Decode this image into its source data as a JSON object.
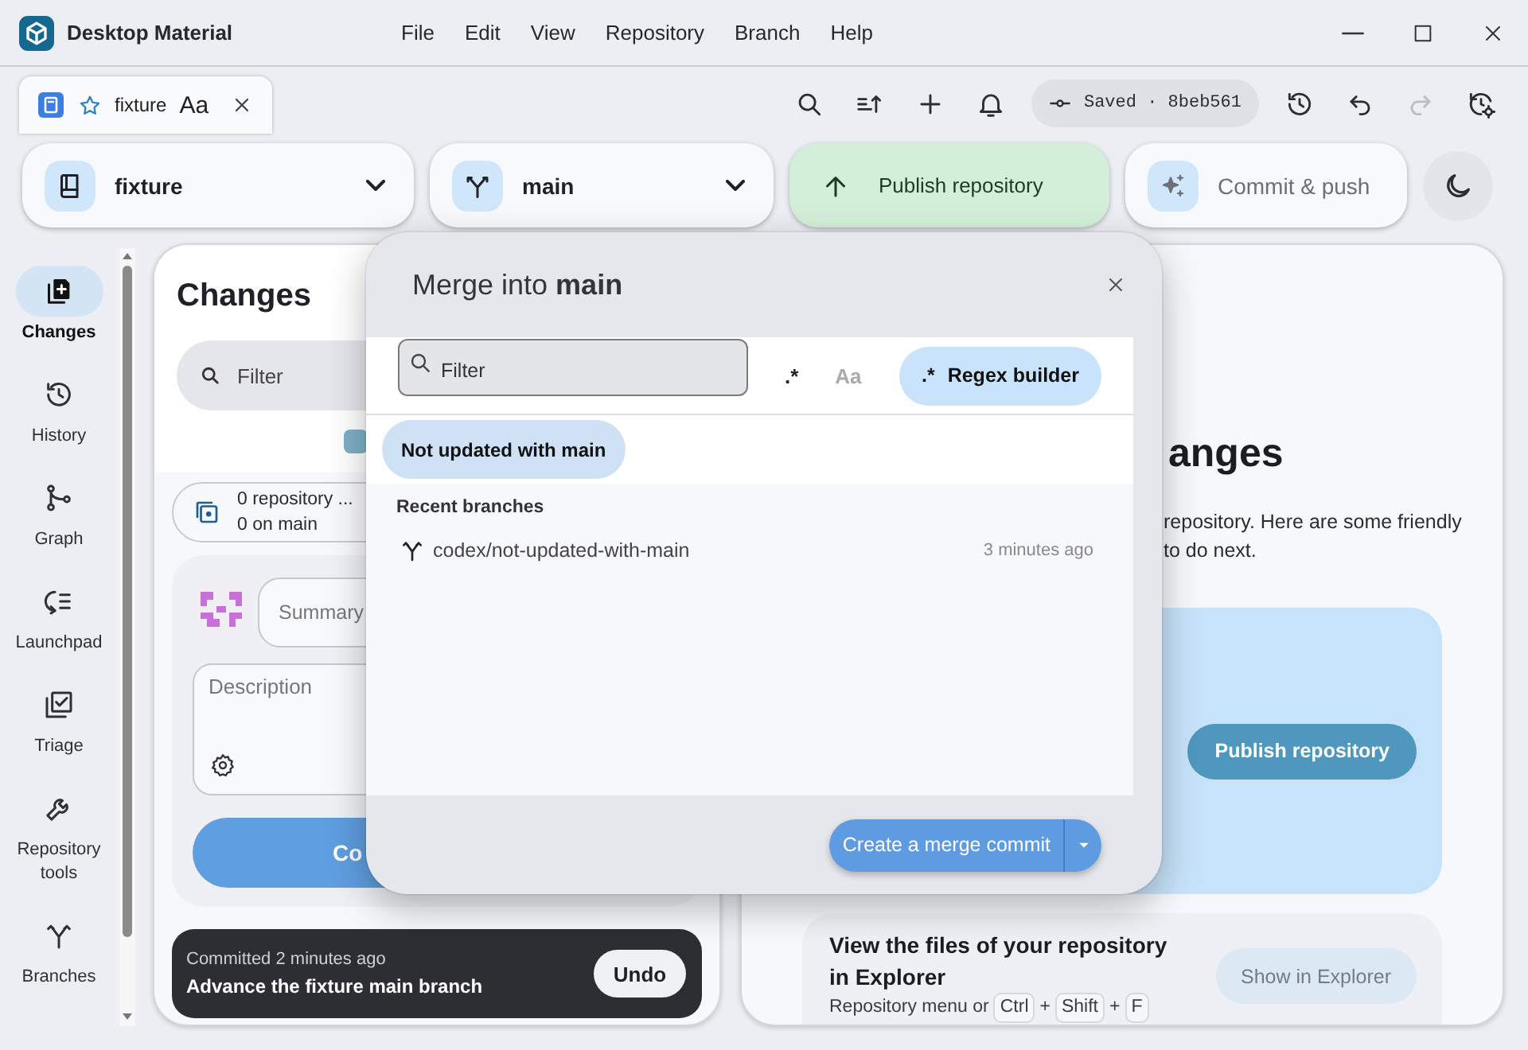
{
  "window": {
    "title": "Desktop Material"
  },
  "menu": [
    "File",
    "Edit",
    "View",
    "Repository",
    "Branch",
    "Help"
  ],
  "tabs": [
    {
      "label": "fixture",
      "badge": "Aa",
      "selected": true
    }
  ],
  "toolbar": [
    {
      "kind": "search",
      "disabled": false
    },
    {
      "kind": "sort",
      "disabled": false
    },
    {
      "kind": "add",
      "disabled": false
    },
    {
      "kind": "bell",
      "disabled": false
    },
    {
      "kind": "status",
      "text": "Saved · 8beb561"
    },
    {
      "kind": "history",
      "disabled": false
    },
    {
      "kind": "undo",
      "disabled": false
    },
    {
      "kind": "redo",
      "disabled": true
    },
    {
      "kind": "history-settings",
      "disabled": false
    }
  ],
  "repo_bar": {
    "repository": "fixture",
    "branch": "main",
    "publish": "Publish repository",
    "commit_push": {
      "label": "Commit & push",
      "disabled": true
    }
  },
  "sidebar": {
    "items": [
      {
        "kind": "changes",
        "label": "Changes",
        "selected": true
      },
      {
        "kind": "history",
        "label": "History",
        "selected": false
      },
      {
        "kind": "graph",
        "label": "Graph",
        "selected": false
      },
      {
        "kind": "launchpad",
        "label": "Launchpad",
        "selected": false
      },
      {
        "kind": "triage",
        "label": "Triage",
        "selected": false
      },
      {
        "kind": "tools",
        "label": "Repository tools",
        "selected": false
      },
      {
        "kind": "branches",
        "label": "Branches",
        "selected": false
      }
    ]
  },
  "changes_panel": {
    "title": "Changes",
    "filter_placeholder": "Filter",
    "stats": [
      "0 repository ...",
      "0 on main"
    ],
    "summary_placeholder": "Summary",
    "description_placeholder": "Description",
    "commit_button": "Co",
    "toast": {
      "caption": "Committed 2 minutes ago",
      "message": "Advance the fixture main branch",
      "button": "Undo"
    }
  },
  "welcome": {
    "heading": "anges",
    "lines": [
      "repository. Here are some friendly",
      "to do next."
    ],
    "publish_button": "Publish repository",
    "explorer": {
      "title": "View the files of your repository in Explorer",
      "hint": [
        {
          "kind": "text",
          "text": "Repository menu or"
        },
        {
          "kind": "key",
          "text": "Ctrl"
        },
        {
          "kind": "text",
          "text": "+"
        },
        {
          "kind": "key",
          "text": "Shift"
        },
        {
          "kind": "text",
          "text": "+"
        },
        {
          "kind": "key",
          "text": "F"
        }
      ],
      "button": {
        "label": "Show in Explorer",
        "disabled": true
      }
    }
  },
  "dialog": {
    "title": "Merge into **main**",
    "filter_placeholder": "Filter",
    "toggles": [
      {
        "label": ".*",
        "on": true
      },
      {
        "label": "Aa",
        "on": false
      }
    ],
    "regex_button": {
      "icon": ".*",
      "label": "Regex builder"
    },
    "chips": [
      {
        "label": "Not updated with main",
        "selected": true
      }
    ],
    "section": "Recent branches",
    "branches": [
      {
        "name": "codex/not-updated-with-main",
        "time": "3 minutes ago"
      }
    ],
    "primary_button": "Create a merge commit"
  }
}
